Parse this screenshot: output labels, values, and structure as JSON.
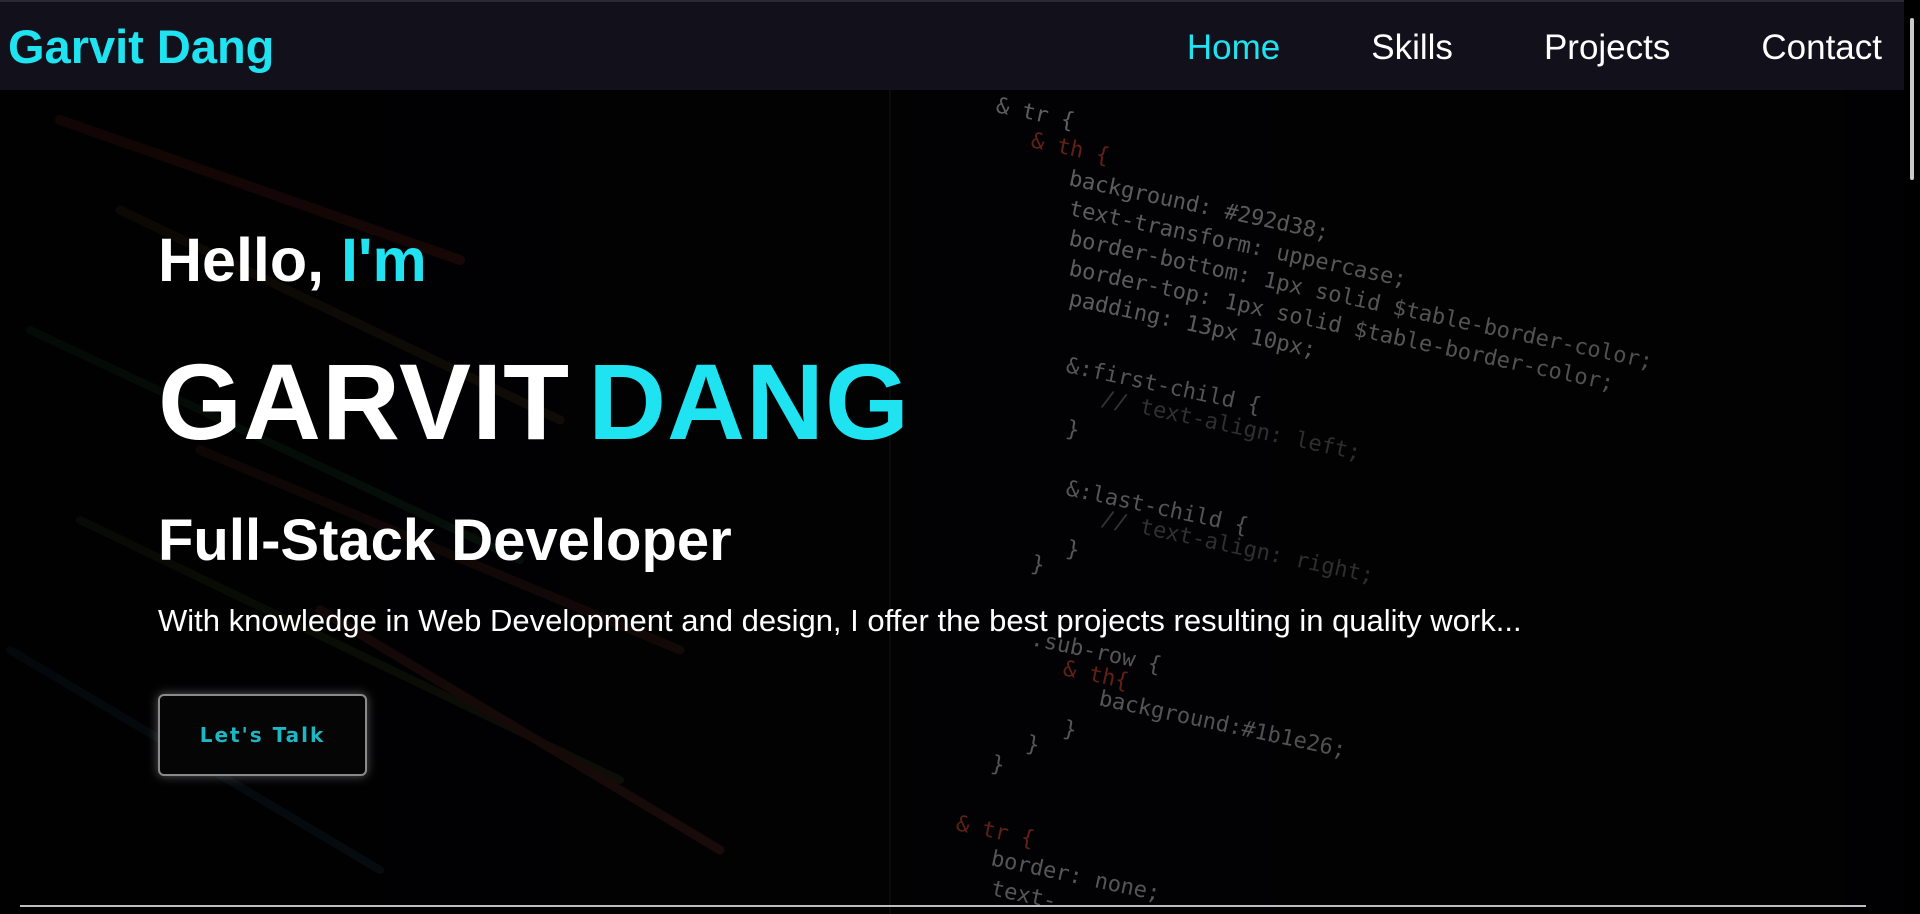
{
  "nav": {
    "brand": "Garvit Dang",
    "links": [
      {
        "label": "Home",
        "active": true
      },
      {
        "label": "Skills",
        "active": false
      },
      {
        "label": "Projects",
        "active": false
      },
      {
        "label": "Contact",
        "active": false
      }
    ]
  },
  "hero": {
    "greeting_prefix": "Hello,",
    "greeting_accent": "I'm",
    "name_first": "GARVIT",
    "name_last": "DANG",
    "title": "Full-Stack Developer",
    "description": "With knowledge in Web Development and design, I offer the best projects resulting in quality work...",
    "cta_label": "Let's Talk"
  },
  "background_code": [
    "& tr {",
    "& th {",
    "background: #292d38;",
    "text-transform: uppercase;",
    "border-bottom: 1px solid $table-border-color;",
    "border-top: 1px solid $table-border-color;",
    "padding: 13px 10px;",
    "&:first-child {",
    "// text-align: left;",
    "}",
    "&:last-child {",
    "// text-align: right;",
    "}",
    "}",
    ".sub-row {",
    "& th{",
    "background:#1b1e26;",
    "}",
    "}",
    "}",
    "& tr {",
    "border: none;",
    "text-"
  ],
  "colors": {
    "accent": "#1fe3f0",
    "navbar_bg": "#12111b",
    "page_bg": "#030305",
    "cta_text": "#1fb6c4"
  }
}
